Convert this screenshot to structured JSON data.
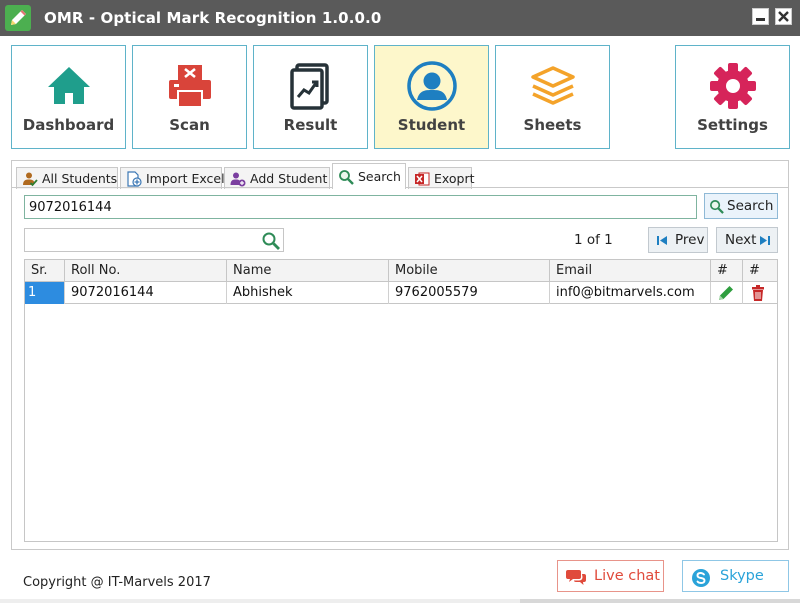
{
  "window": {
    "title": "OMR - Optical Mark Recognition 1.0.0.0"
  },
  "nav": [
    {
      "label": "Dashboard",
      "icon": "home-icon"
    },
    {
      "label": "Scan",
      "icon": "printer-icon"
    },
    {
      "label": "Result",
      "icon": "chart-document-icon"
    },
    {
      "label": "Student",
      "icon": "user-icon",
      "active": true
    },
    {
      "label": "Sheets",
      "icon": "stack-layers-icon"
    },
    {
      "label": "Settings",
      "icon": "gear-icon"
    }
  ],
  "tabs": [
    {
      "label": "All Students",
      "icon": "user-check-icon"
    },
    {
      "label": "Import Excel",
      "icon": "import-icon"
    },
    {
      "label": "Add Student",
      "icon": "user-add-icon"
    },
    {
      "label": "Search",
      "icon": "search-icon",
      "active": true
    },
    {
      "label": "Exoprt",
      "icon": "excel-icon"
    }
  ],
  "search": {
    "value": "9072016144",
    "button_label": "Search"
  },
  "filter": {
    "value": ""
  },
  "pager": {
    "info": "1 of 1",
    "prev_label": "Prev",
    "next_label": "Next"
  },
  "table": {
    "columns": [
      "Sr.",
      "Roll No.",
      "Name",
      "Mobile",
      "Email",
      "#",
      "#"
    ],
    "rows": [
      {
        "sr": "1",
        "roll": "9072016144",
        "name": "Abhishek",
        "mobile": "9762005579",
        "email": "inf0@bitmarvels.com"
      }
    ]
  },
  "footer": {
    "copyright": "Copyright @ IT-Marvels 2017",
    "live_chat_label": "Live chat",
    "skype_label": "Skype"
  },
  "colors": {
    "accent": "#5fb3c9",
    "active_tile": "#fdf7cb",
    "selected_cell": "#2d8ce0",
    "live_chat": "#e04a3b",
    "skype": "#2aa3d9"
  }
}
